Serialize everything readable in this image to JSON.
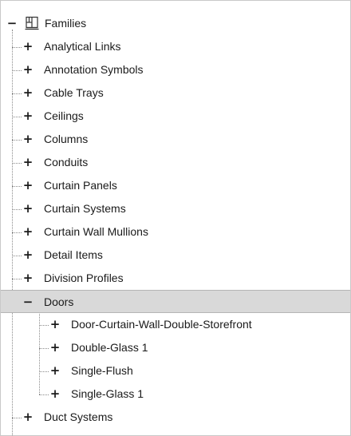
{
  "tree": {
    "root": {
      "label": "Families",
      "toggle": "−",
      "icon": "families-icon"
    },
    "level1_before": [
      {
        "label": "Analytical Links",
        "toggle": "+"
      },
      {
        "label": "Annotation Symbols",
        "toggle": "+"
      },
      {
        "label": "Cable Trays",
        "toggle": "+"
      },
      {
        "label": "Ceilings",
        "toggle": "+"
      },
      {
        "label": "Columns",
        "toggle": "+"
      },
      {
        "label": "Conduits",
        "toggle": "+"
      },
      {
        "label": "Curtain Panels",
        "toggle": "+"
      },
      {
        "label": "Curtain Systems",
        "toggle": "+"
      },
      {
        "label": "Curtain Wall Mullions",
        "toggle": "+"
      },
      {
        "label": "Detail Items",
        "toggle": "+"
      },
      {
        "label": "Division Profiles",
        "toggle": "+"
      }
    ],
    "selected": {
      "label": "Doors",
      "toggle": "−"
    },
    "children": [
      {
        "label": "Door-Curtain-Wall-Double-Storefront",
        "toggle": "+"
      },
      {
        "label": "Double-Glass 1",
        "toggle": "+"
      },
      {
        "label": "Single-Flush",
        "toggle": "+"
      },
      {
        "label": "Single-Glass 1",
        "toggle": "+"
      }
    ],
    "level1_after": [
      {
        "label": "Duct Systems",
        "toggle": "+"
      }
    ]
  },
  "colors": {
    "selected_bg": "#d9d9d9",
    "text": "#1a1a1a",
    "tree_lines": "#8a8a8a"
  }
}
